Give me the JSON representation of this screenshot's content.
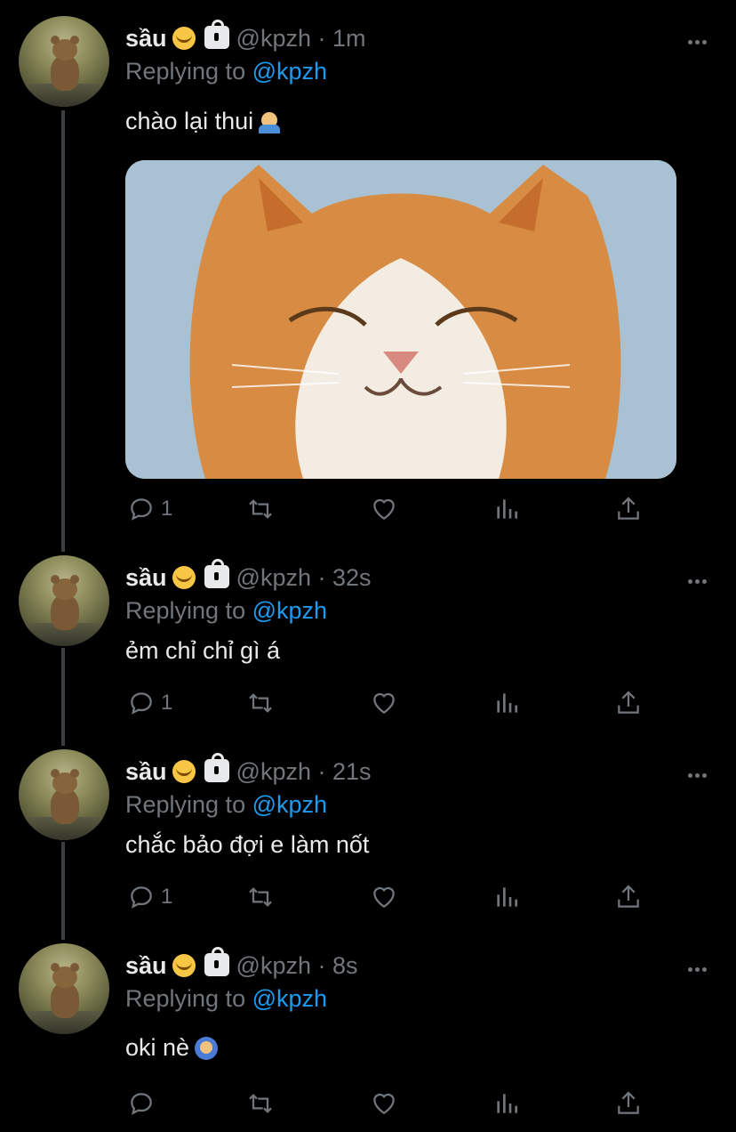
{
  "tweets": [
    {
      "name": "sầu",
      "handle": "@kpzh",
      "time": "1m",
      "replying_prefix": "Replying to",
      "replying_to": "@kpzh",
      "text": "chào lại thui",
      "emoji": "person-raising-hand-emoji",
      "has_media": true,
      "reply_count": "1"
    },
    {
      "name": "sầu",
      "handle": "@kpzh",
      "time": "32s",
      "replying_prefix": "Replying to",
      "replying_to": "@kpzh",
      "text": "ẻm chỉ chỉ gì á",
      "reply_count": "1"
    },
    {
      "name": "sầu",
      "handle": "@kpzh",
      "time": "21s",
      "replying_prefix": "Replying to",
      "replying_to": "@kpzh",
      "text": "chắc bảo đợi e làm nốt",
      "reply_count": "1"
    },
    {
      "name": "sầu",
      "handle": "@kpzh",
      "time": "8s",
      "replying_prefix": "Replying to",
      "replying_to": "@kpzh",
      "text": "oki nè",
      "emoji": "person-bowing-emoji",
      "reply_count": ""
    }
  ],
  "separator": "·",
  "icons": {
    "name_emoji": "melting-face-emoji",
    "protected": "lock-icon",
    "more": "more-options-icon",
    "reply": "reply-icon",
    "retweet": "retweet-icon",
    "like": "like-icon",
    "views": "views-icon",
    "share": "share-icon"
  },
  "colors": {
    "background": "#000000",
    "text": "#e7e9ea",
    "muted": "#71767b",
    "link": "#1d9bf0",
    "thread_line": "#3a3d41"
  }
}
